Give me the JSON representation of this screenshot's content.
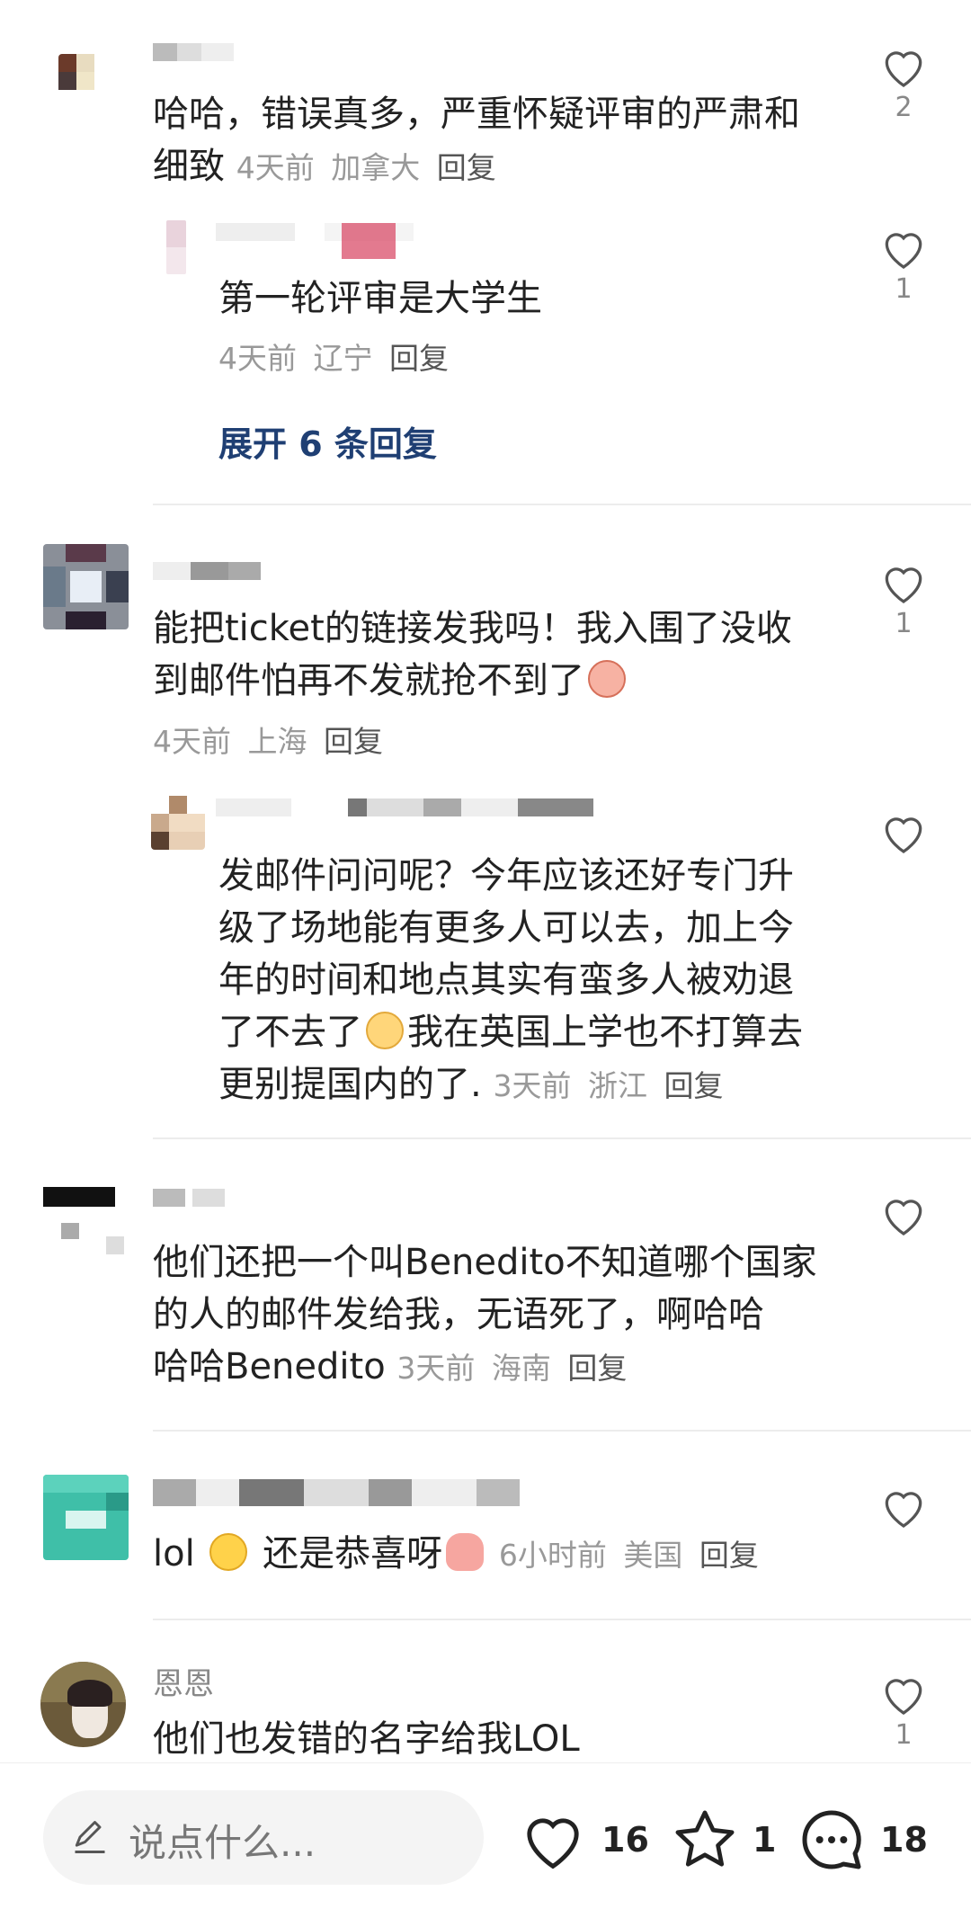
{
  "icons": {
    "like": "heart-outline-icon",
    "star": "star-outline-icon",
    "comment": "chat-bubble-icon",
    "edit": "pencil-icon"
  },
  "colors": {
    "text": "#222222",
    "meta": "#999999",
    "expand_link": "#1f3f73",
    "divider": "#ececec"
  },
  "comments": [
    {
      "text": "哈哈，错误真多，严重怀疑评审的严肃和细致",
      "time": "4天前",
      "location": "加拿大",
      "reply_label": "回复",
      "likes": "2"
    },
    {
      "text": "第一轮评审是大学生",
      "time": "4天前",
      "location": "辽宁",
      "reply_label": "回复",
      "likes": "1"
    },
    {
      "text_line1": "能把ticket的链接发我吗！我入围了没收",
      "text_line2": "到邮件怕再不发就抢不到了",
      "time": "4天前",
      "location": "上海",
      "reply_label": "回复",
      "likes": "1"
    },
    {
      "text_line1": "发邮件问问呢？今年应该还好专门升",
      "text_line2": "级了场地能有更多人可以去，加上今",
      "text_line3": "年的时间和地点其实有蛮多人被劝退",
      "text_line4a": "了不去了",
      "text_line4b": "我在英国上学也不打算去",
      "text_line5": "更别提国内的了.",
      "time": "3天前",
      "location": "浙江",
      "reply_label": "回复",
      "likes": ""
    },
    {
      "text_line1": "他们还把一个叫Benedito不知道哪个国家",
      "text_line2": "的人的邮件发给我，无语死了，啊哈哈",
      "text_line3": "哈哈Benedito",
      "time": "3天前",
      "location": "海南",
      "reply_label": "回复",
      "likes": ""
    },
    {
      "text_a": "lol",
      "text_b": "还是恭喜呀",
      "time": "6小时前",
      "location": "美国",
      "reply_label": "回复",
      "likes": ""
    },
    {
      "author": "恩恩",
      "text": "他们也发错的名字给我LOL",
      "likes": "1"
    }
  ],
  "expand_replies": "展开 6 条回复",
  "bottom_bar": {
    "placeholder": "说点什么...",
    "likes": "16",
    "stars": "1",
    "comments": "18"
  }
}
